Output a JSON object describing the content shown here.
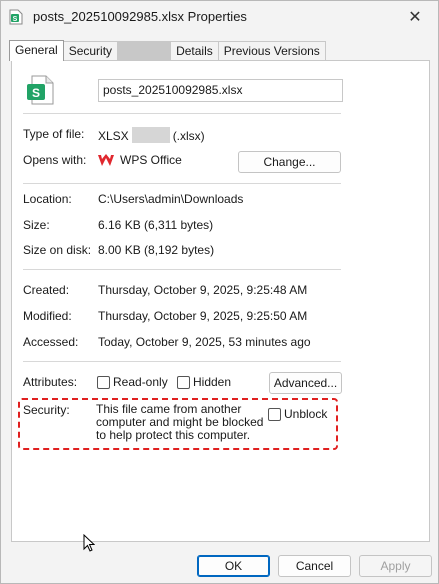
{
  "window": {
    "title": "posts_202510092985.xlsx Properties",
    "close_glyph": "✕"
  },
  "tabs": [
    {
      "label": "General",
      "active": true
    },
    {
      "label": "Security",
      "active": false
    },
    {
      "label": "",
      "active": false,
      "redacted": true
    },
    {
      "label": "Details",
      "active": false
    },
    {
      "label": "Previous Versions",
      "active": false
    }
  ],
  "general": {
    "file_name": "posts_202510092985.xlsx",
    "type_label": "Type of file:",
    "type_value_prefix": "XLSX",
    "type_value_suffix": "(.xlsx)",
    "opens_label": "Opens with:",
    "opens_app": "WPS Office",
    "change_button": "Change...",
    "location_label": "Location:",
    "location_value": "C:\\Users\\admin\\Downloads",
    "size_label": "Size:",
    "size_value": "6.16 KB (6,311 bytes)",
    "size_disk_label": "Size on disk:",
    "size_disk_value": "8.00 KB (8,192 bytes)",
    "created_label": "Created:",
    "created_value": "Thursday, October 9, 2025, 9:25:48 AM",
    "modified_label": "Modified:",
    "modified_value": "Thursday, October 9, 2025, 9:25:50 AM",
    "accessed_label": "Accessed:",
    "accessed_value": "Today, October 9, 2025, 53 minutes ago",
    "attributes_label": "Attributes:",
    "readonly_label": "Read-only",
    "hidden_label": "Hidden",
    "advanced_button": "Advanced...",
    "security_label": "Security:",
    "security_text": "This file came from another computer and might be blocked to help protect this computer.",
    "unblock_label": "Unblock"
  },
  "footer": {
    "ok": "OK",
    "cancel": "Cancel",
    "apply": "Apply"
  },
  "colors": {
    "accent": "#0067c0",
    "excel_green": "#21a366",
    "wps_red": "#e0282e",
    "warning_red": "#e02020"
  }
}
